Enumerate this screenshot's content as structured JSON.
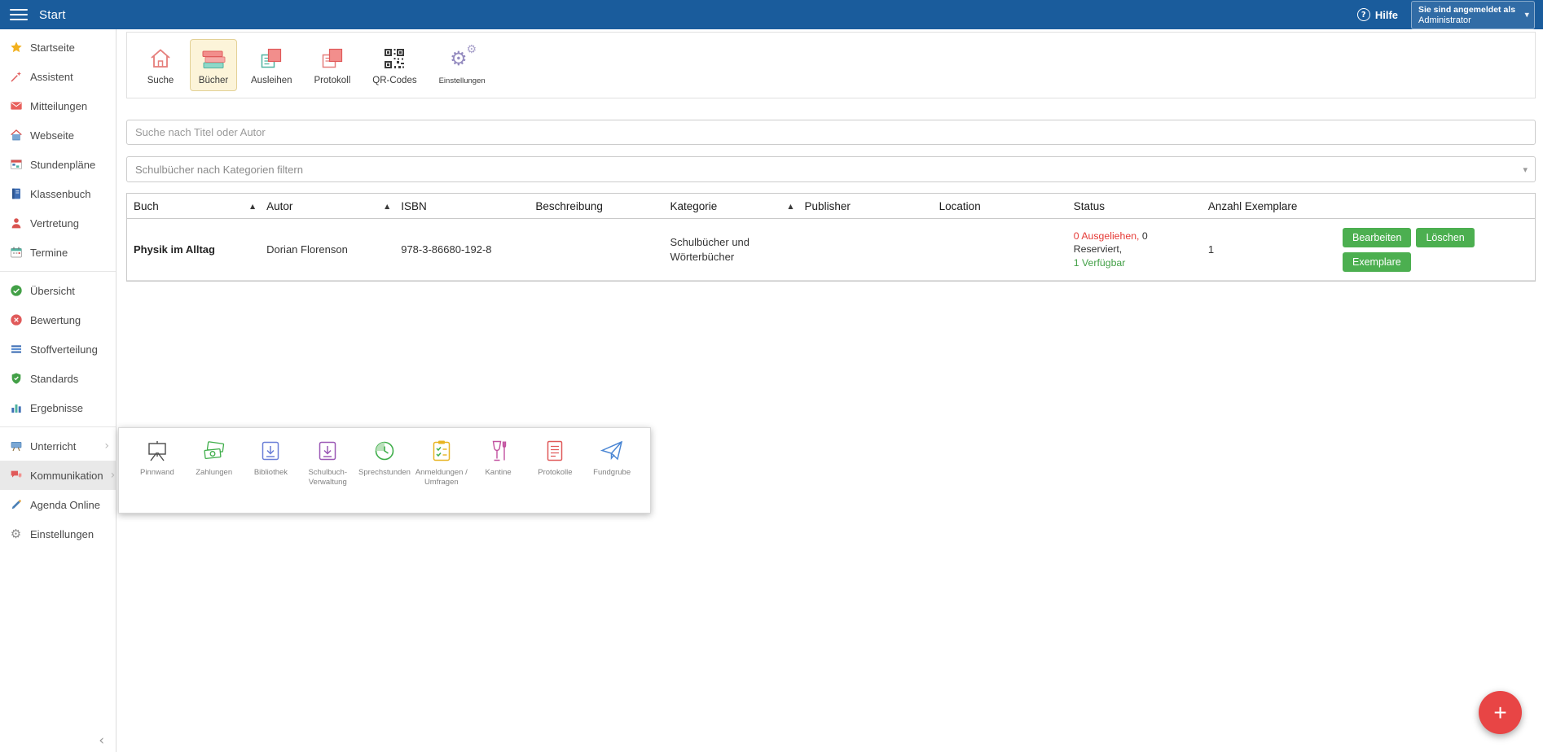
{
  "topbar": {
    "title": "Start",
    "help_icon": "?",
    "help_label": "Hilfe",
    "login_label": "Sie sind angemeldet als",
    "login_user": "Administrator"
  },
  "sidebar": {
    "items": [
      {
        "label": "Startseite",
        "icon": "star"
      },
      {
        "label": "Assistent",
        "icon": "wand"
      },
      {
        "label": "Mitteilungen",
        "icon": "mail"
      },
      {
        "label": "Webseite",
        "icon": "home"
      },
      {
        "label": "Stundenpläne",
        "icon": "timetable"
      },
      {
        "label": "Klassenbuch",
        "icon": "book"
      },
      {
        "label": "Vertretung",
        "icon": "person"
      },
      {
        "label": "Termine",
        "icon": "calendar"
      },
      {
        "label": "Übersicht",
        "icon": "check-circle"
      },
      {
        "label": "Bewertung",
        "icon": "red-circle"
      },
      {
        "label": "Stoffverteilung",
        "icon": "lines"
      },
      {
        "label": "Standards",
        "icon": "shield"
      },
      {
        "label": "Ergebnisse",
        "icon": "bar-chart"
      },
      {
        "label": "Unterricht",
        "icon": "desk"
      },
      {
        "label": "Kommunikation",
        "icon": "speech-bubbles",
        "active": true
      },
      {
        "label": "Agenda Online",
        "icon": "pencil"
      },
      {
        "label": "Einstellungen",
        "icon": "gear"
      }
    ]
  },
  "toolbar": {
    "tabs": [
      {
        "label": "Suche",
        "icon": "house"
      },
      {
        "label": "Bücher",
        "icon": "book-stack",
        "active": true
      },
      {
        "label": "Ausleihen",
        "icon": "lend-cards"
      },
      {
        "label": "Protokoll",
        "icon": "protocol-cards"
      },
      {
        "label": "QR-Codes",
        "icon": "qr-code"
      },
      {
        "label": "Einstellungen",
        "icon": "gears"
      }
    ]
  },
  "filters": {
    "search_placeholder": "Suche nach Titel oder Autor",
    "category_placeholder": "Schulbücher nach Kategorien filtern"
  },
  "table": {
    "sort_icon": "▲",
    "columns": [
      "Buch",
      "Autor",
      "ISBN",
      "Beschreibung",
      "Kategorie",
      "Publisher",
      "Location",
      "Status",
      "Anzahl Exemplare"
    ],
    "rows": [
      {
        "buch": "Physik im Alltag",
        "autor": "Dorian Florenson",
        "isbn": "978-3-86680-192-8",
        "beschreibung": "",
        "kategorie": "Schulbücher und Wörterbücher",
        "publisher": "",
        "location": "",
        "status": {
          "ausgeliehen": "0 Ausgeliehen,",
          "reserviert": "0 Reserviert,",
          "verfuegbar": "1 Verfügbar"
        },
        "anzahl": "1",
        "actions": [
          "Bearbeiten",
          "Löschen",
          "Exemplare"
        ]
      }
    ]
  },
  "popup": {
    "items": [
      "Pinnwand",
      "Zahlungen",
      "Bibliothek",
      "Schulbuch-Verwaltung",
      "Sprechstunden",
      "Anmeldungen / Umfragen",
      "Kantine",
      "Protokolle",
      "Fundgrube"
    ]
  },
  "fab": {
    "label": "+"
  },
  "colors": {
    "topbar_blue": "#1a5c9c",
    "button_green": "#4caf50",
    "status_red": "#e53935",
    "status_green": "#43a047",
    "fab_red": "#e84545",
    "active_tab_bg": "#fcf4d9"
  }
}
